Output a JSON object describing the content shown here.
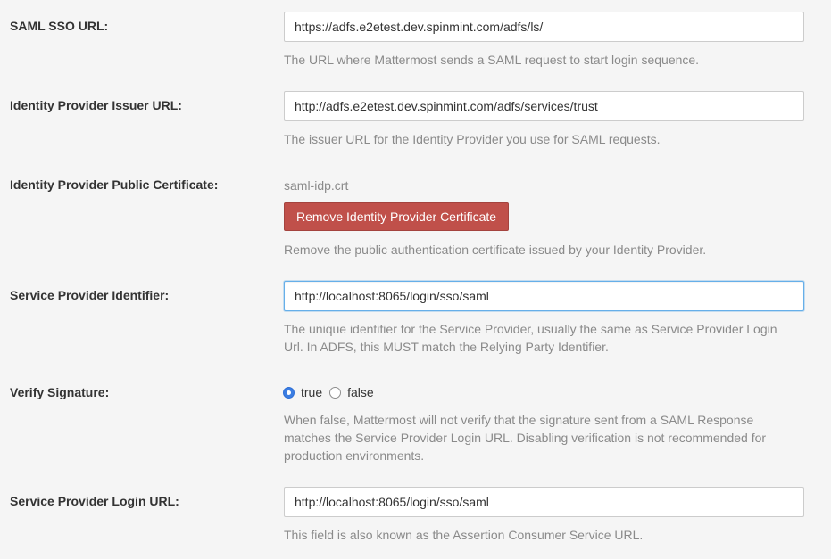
{
  "saml_sso_url": {
    "label": "SAML SSO URL:",
    "value": "https://adfs.e2etest.dev.spinmint.com/adfs/ls/",
    "help": "The URL where Mattermost sends a SAML request to start login sequence."
  },
  "idp_issuer_url": {
    "label": "Identity Provider Issuer URL:",
    "value": "http://adfs.e2etest.dev.spinmint.com/adfs/services/trust",
    "help": "The issuer URL for the Identity Provider you use for SAML requests."
  },
  "idp_public_cert": {
    "label": "Identity Provider Public Certificate:",
    "filename": "saml-idp.crt",
    "remove_button": "Remove Identity Provider Certificate",
    "help": "Remove the public authentication certificate issued by your Identity Provider."
  },
  "sp_identifier": {
    "label": "Service Provider Identifier:",
    "value": "http://localhost:8065/login/sso/saml",
    "help_line1": "The unique identifier for the Service Provider, usually the same as Service Provider Login",
    "help_line2": "Url. In ADFS, this MUST match the Relying Party Identifier."
  },
  "verify_signature": {
    "label": "Verify Signature:",
    "option_true": "true",
    "option_false": "false",
    "selected": "true",
    "help_line1": "When false, Mattermost will not verify that the signature sent from a SAML Response",
    "help_line2": "matches the Service Provider Login URL. Disabling verification is not recommended for",
    "help_line3": "production environments."
  },
  "sp_login_url": {
    "label": "Service Provider Login URL:",
    "value": "http://localhost:8065/login/sso/saml",
    "help": "This field is also known as the Assertion Consumer Service URL."
  },
  "colors": {
    "background": "#f5f5f5",
    "danger_button": "#c0504a",
    "focus_border": "#66afe9",
    "radio_checked": "#3b7de2",
    "help_text": "#8a8a8a"
  }
}
